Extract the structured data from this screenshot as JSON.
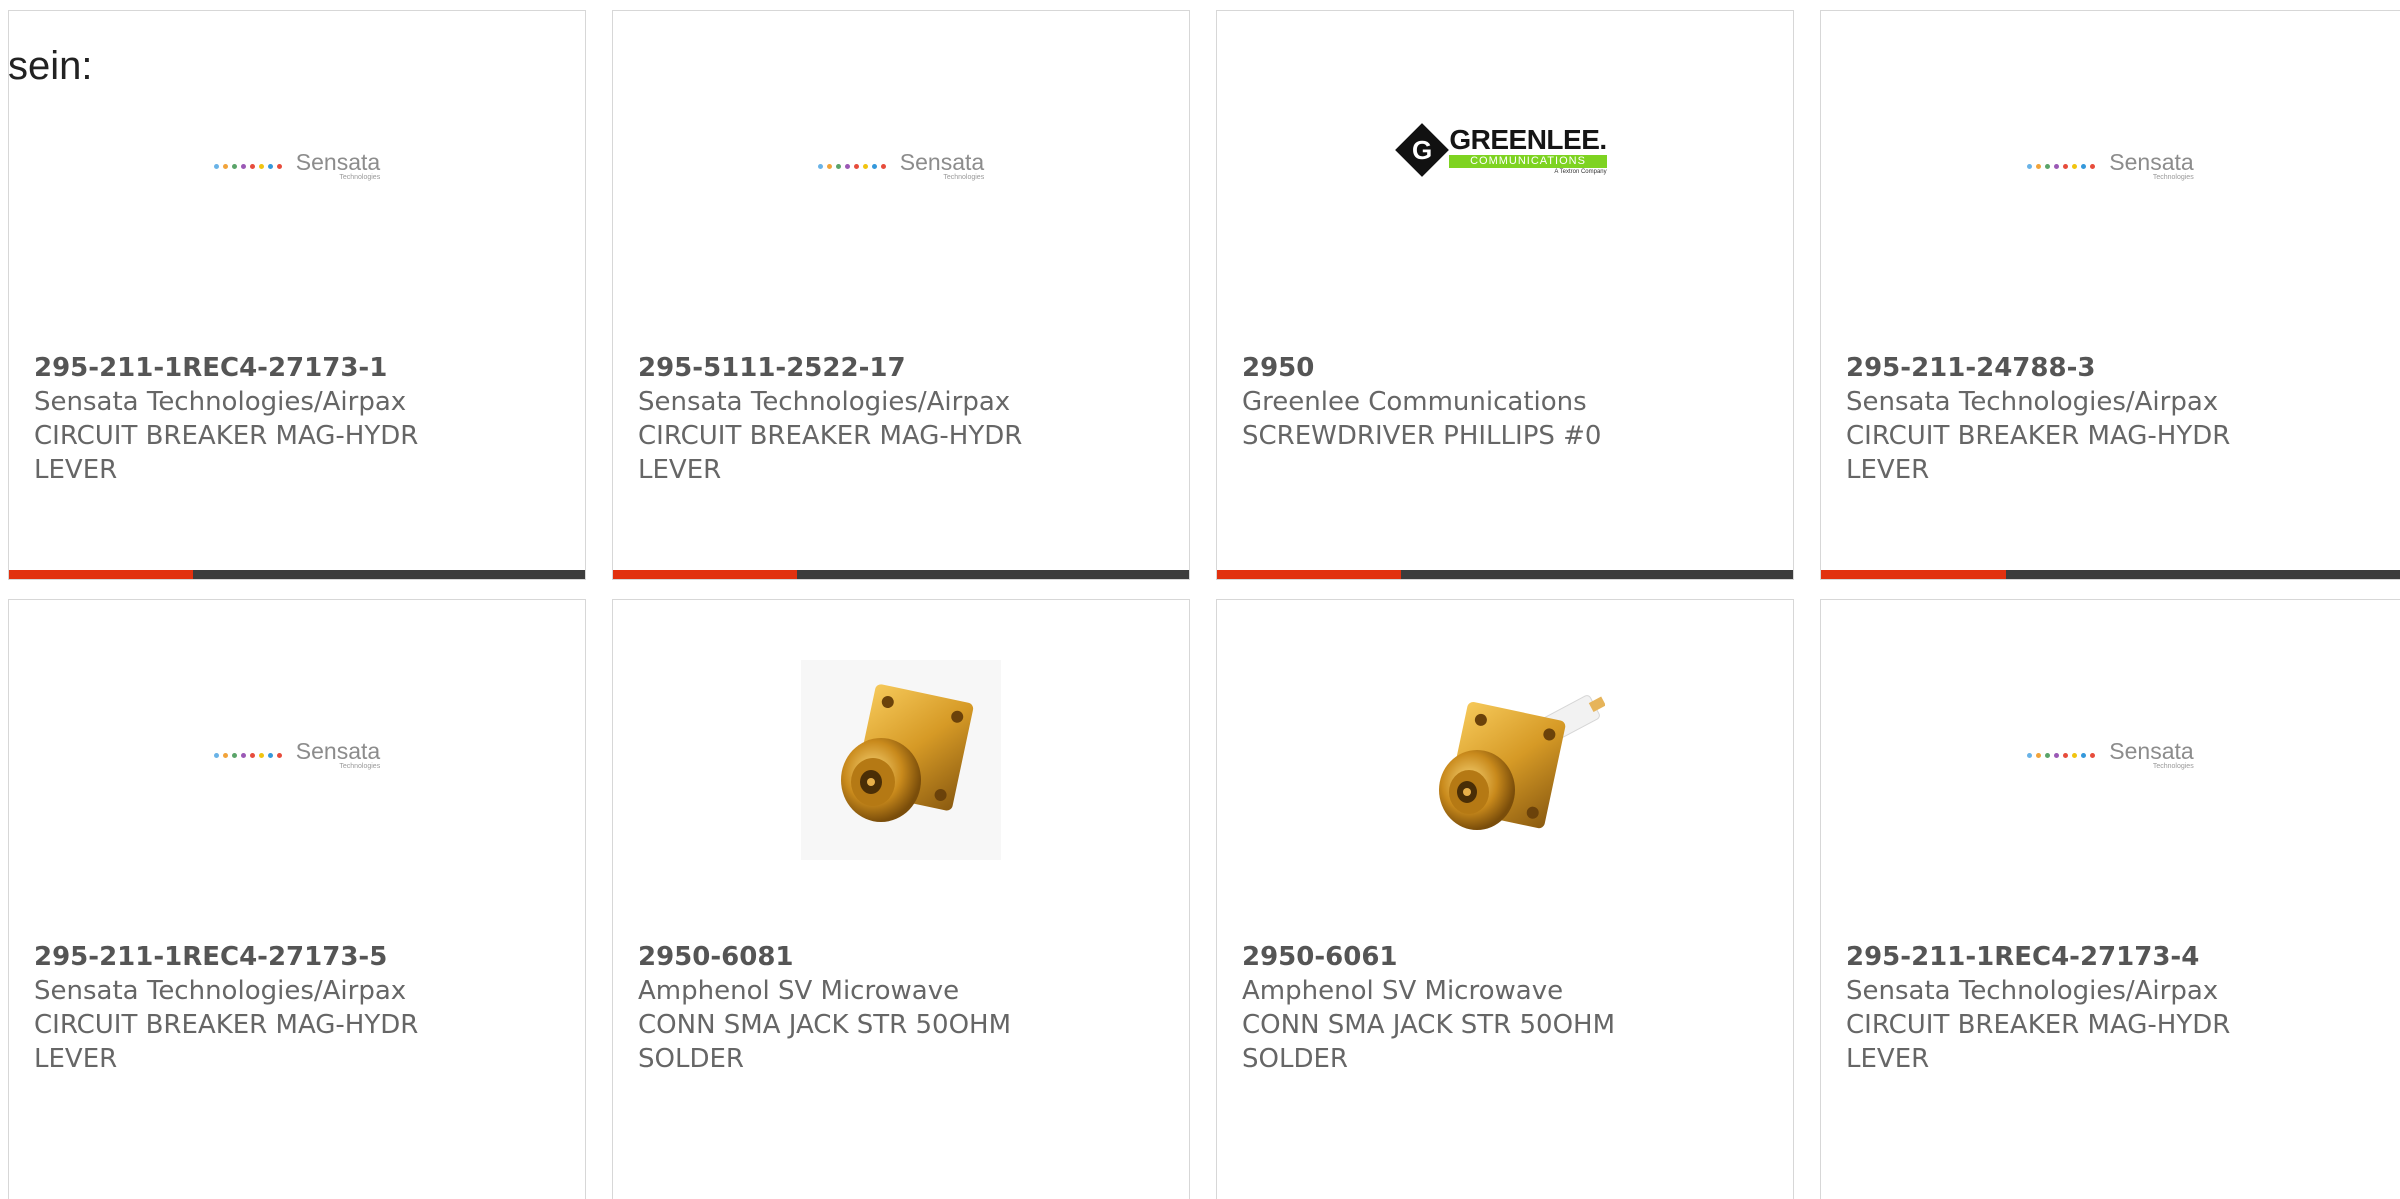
{
  "page": {
    "heading": "sein:"
  },
  "colors": {
    "accent_bar": "#e2310f",
    "bar_track": "#3c3c3c",
    "card_border": "#d7d7d7",
    "text": "#666666"
  },
  "products": [
    {
      "part_number": "295-211-1REC4-27173-1",
      "manufacturer": "Sensata Technologies/Airpax",
      "description": "CIRCUIT BREAKER MAG-HYDR LEVER",
      "logo": "sensata-logo"
    },
    {
      "part_number": "295-5111-2522-17",
      "manufacturer": "Sensata Technologies/Airpax",
      "description": "CIRCUIT BREAKER MAG-HYDR LEVER",
      "logo": "sensata-logo"
    },
    {
      "part_number": "2950",
      "manufacturer": "Greenlee Communications",
      "description": "SCREWDRIVER PHILLIPS #0",
      "logo": "greenlee-logo"
    },
    {
      "part_number": "295-211-24788-3",
      "manufacturer": "Sensata Technologies/Airpax",
      "description": "CIRCUIT BREAKER MAG-HYDR LEVER",
      "logo": "sensata-logo"
    },
    {
      "part_number": "295-211-1REC4-27173-5",
      "manufacturer": "Sensata Technologies/Airpax",
      "description": "CIRCUIT BREAKER MAG-HYDR LEVER",
      "logo": "sensata-logo"
    },
    {
      "part_number": "2950-6081",
      "manufacturer": "Amphenol SV Microwave",
      "description": "CONN SMA JACK STR 50OHM SOLDER",
      "logo": "sma-connector-image"
    },
    {
      "part_number": "2950-6061",
      "manufacturer": "Amphenol SV Microwave",
      "description": "CONN SMA JACK STR 50OHM SOLDER",
      "logo": "sma-connector-pin-image"
    },
    {
      "part_number": "295-211-1REC4-27173-4",
      "manufacturer": "Sensata Technologies/Airpax",
      "description": "CIRCUIT BREAKER MAG-HYDR LEVER",
      "logo": "sensata-logo"
    }
  ],
  "logos": {
    "sensata": {
      "name": "Sensata",
      "sub": "Technologies"
    },
    "greenlee": {
      "letter": "G",
      "brand": "GREENLEE.",
      "line2": "COMMUNICATIONS",
      "tagline": "A Textron Company"
    }
  },
  "progress": {
    "fill_fraction": 0.32
  }
}
